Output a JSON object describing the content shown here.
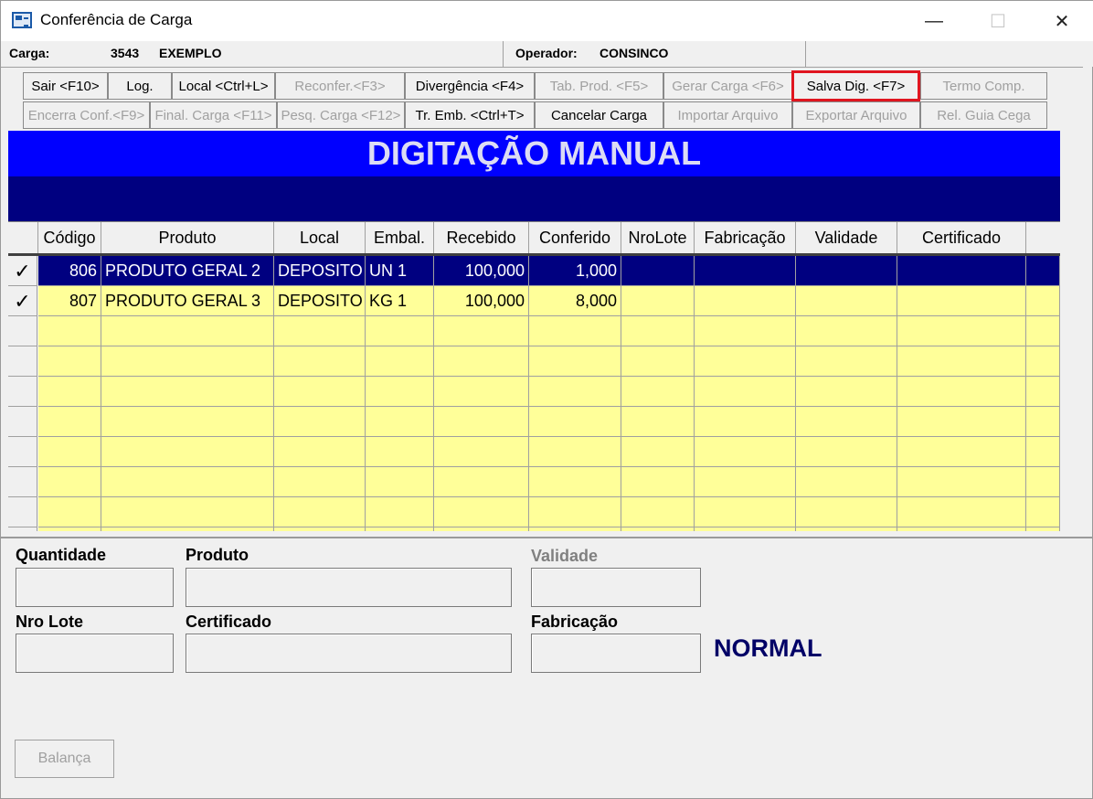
{
  "window": {
    "title": "Conferência de Carga",
    "icon": "app-window-icon"
  },
  "controls": {
    "minimize": "—",
    "maximize": "☐",
    "close": "✕"
  },
  "info": {
    "carga_label": "Carga:",
    "carga_num": "3543",
    "carga_name": "EXEMPLO",
    "operador_label": "Operador:",
    "operador_value": "CONSINCO"
  },
  "toolbar": {
    "row1": [
      {
        "label": "Sair <F10>",
        "enabled": true
      },
      {
        "label": "Log.",
        "enabled": true
      },
      {
        "label": "Local <Ctrl+L>",
        "enabled": true
      },
      {
        "label": "Reconfer.<F3>",
        "enabled": false
      },
      {
        "label": "Divergência <F4>",
        "enabled": true
      },
      {
        "label": "Tab. Prod. <F5>",
        "enabled": false
      },
      {
        "label": "Gerar Carga <F6>",
        "enabled": false
      },
      {
        "label": "Salva Dig. <F7>",
        "enabled": true,
        "highlighted": true
      },
      {
        "label": "Termo Comp.",
        "enabled": false
      }
    ],
    "row2": [
      {
        "label": "Encerra Conf.<F9>",
        "enabled": false
      },
      {
        "label": "Final. Carga <F11>",
        "enabled": false
      },
      {
        "label": "Pesq. Carga <F12>",
        "enabled": false
      },
      {
        "label": "Tr. Emb. <Ctrl+T>",
        "enabled": true
      },
      {
        "label": "Cancelar Carga",
        "enabled": true
      },
      {
        "label": "Importar Arquivo",
        "enabled": false
      },
      {
        "label": "Exportar Arquivo",
        "enabled": false
      },
      {
        "label": "Rel. Guia Cega",
        "enabled": false
      }
    ]
  },
  "banner": {
    "title": "DIGITAÇÃO MANUAL"
  },
  "grid": {
    "columns": [
      "Código",
      "Produto",
      "Local",
      "Embal.",
      "Recebido",
      "Conferido",
      "NroLote",
      "Fabricação",
      "Validade",
      "Certificado"
    ],
    "rows": [
      {
        "checked": "✓",
        "codigo": "806",
        "produto": "PRODUTO GERAL 2",
        "local": "DEPOSITO",
        "embal": "UN  1",
        "recebido": "100,000",
        "conferido": "1,000",
        "nrolote": "",
        "fabricacao": "",
        "validade": "",
        "certificado": "",
        "selected": true
      },
      {
        "checked": "✓",
        "codigo": "807",
        "produto": "PRODUTO GERAL 3",
        "local": "DEPOSITO",
        "embal": "KG  1",
        "recebido": "100,000",
        "conferido": "8,000",
        "nrolote": "",
        "fabricacao": "",
        "validade": "",
        "certificado": "",
        "selected": false
      }
    ],
    "empty_rows": 8
  },
  "form": {
    "quantidade": {
      "label": "Quantidade",
      "value": ""
    },
    "produto": {
      "label": "Produto",
      "value": ""
    },
    "validade": {
      "label": "Validade",
      "value": ""
    },
    "nro_lote": {
      "label": "Nro Lote",
      "value": ""
    },
    "certificado": {
      "label": "Certificado",
      "value": ""
    },
    "fabricacao": {
      "label": "Fabricação",
      "value": ""
    },
    "status": "NORMAL",
    "balanca_label": "Balança"
  }
}
